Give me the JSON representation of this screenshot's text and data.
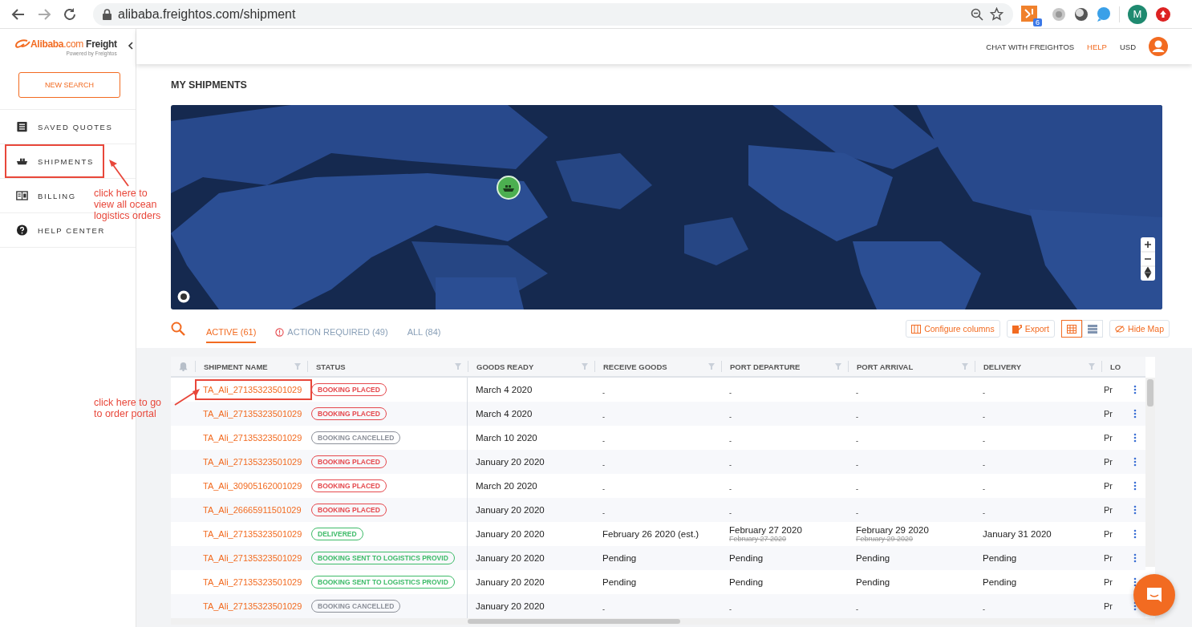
{
  "browser": {
    "url": "alibaba.freightos.com/shipment",
    "extension_badge": "6",
    "profile_initial": "M"
  },
  "sidebar": {
    "logo": {
      "brand": "Alibaba",
      "domain": ".com",
      "product": "Freight",
      "tagline": "Powered by Freightos"
    },
    "new_search": "NEW SEARCH",
    "items": [
      {
        "label": "SAVED QUOTES",
        "kind": "quotes",
        "annotated": false
      },
      {
        "label": "SHIPMENTS",
        "kind": "ship",
        "annotated": true
      },
      {
        "label": "BILLING",
        "kind": "billing",
        "annotated": false
      },
      {
        "label": "HELP CENTER",
        "kind": "help",
        "annotated": false
      }
    ]
  },
  "topbar": {
    "links": [
      {
        "label": "CHAT WITH FREIGHTOS",
        "selected": false
      },
      {
        "label": "HELP",
        "selected": true
      },
      {
        "label": "USD",
        "selected": false
      }
    ]
  },
  "page_title": "MY SHIPMENTS",
  "tabs": [
    {
      "label": "ACTIVE (61)",
      "selected": true,
      "alert": false
    },
    {
      "label": "ACTION REQUIRED (49)",
      "selected": false,
      "alert": true
    },
    {
      "label": "ALL (84)",
      "selected": false,
      "alert": false
    }
  ],
  "toolbar": {
    "configure": "Configure columns",
    "export": "Export",
    "views": [
      {
        "kind": "grid",
        "selected": true
      },
      {
        "kind": "list",
        "selected": false
      }
    ],
    "hide_map": "Hide Map"
  },
  "table": {
    "columns": [
      {
        "label": "SHIPMENT NAME",
        "filterable": true
      },
      {
        "label": "STATUS",
        "filterable": true
      },
      {
        "label": "GOODS READY",
        "filterable": true
      },
      {
        "label": "RECEIVE GOODS",
        "filterable": true
      },
      {
        "label": "PORT DEPARTURE",
        "filterable": true
      },
      {
        "label": "PORT ARRIVAL",
        "filterable": true
      },
      {
        "label": "DELIVERY",
        "filterable": true
      },
      {
        "label": "LO",
        "filterable": false
      }
    ],
    "rows": [
      {
        "name": "TA_Ali_27135323501029",
        "annotated": true,
        "status": {
          "label": "BOOKING PLACED",
          "color": "#e5484d"
        },
        "dates": [
          {
            "value": "March 4 2020"
          },
          {
            "value": "-"
          },
          {
            "value": "-"
          },
          {
            "value": "-"
          },
          {
            "value": "-"
          }
        ],
        "column_8": "Pr"
      },
      {
        "name": "TA_Ali_27135323501029",
        "annotated": false,
        "status": {
          "label": "BOOKING PLACED",
          "color": "#e5484d"
        },
        "dates": [
          {
            "value": "March 4 2020"
          },
          {
            "value": "-"
          },
          {
            "value": "-"
          },
          {
            "value": "-"
          },
          {
            "value": "-"
          }
        ],
        "column_8": "Pr"
      },
      {
        "name": "TA_Ali_27135323501029",
        "annotated": false,
        "status": {
          "label": "BOOKING CANCELLED",
          "color": "#8c9099"
        },
        "dates": [
          {
            "value": "March 10 2020"
          },
          {
            "value": "-"
          },
          {
            "value": "-"
          },
          {
            "value": "-"
          },
          {
            "value": "-"
          }
        ],
        "column_8": "Pr"
      },
      {
        "name": "TA_Ali_27135323501029",
        "annotated": false,
        "status": {
          "label": "BOOKING PLACED",
          "color": "#e5484d"
        },
        "dates": [
          {
            "value": "January 20 2020"
          },
          {
            "value": "-"
          },
          {
            "value": "-"
          },
          {
            "value": "-"
          },
          {
            "value": "-"
          }
        ],
        "column_8": "Pr"
      },
      {
        "name": "TA_Ali_30905162001029",
        "annotated": false,
        "status": {
          "label": "BOOKING PLACED",
          "color": "#e5484d"
        },
        "dates": [
          {
            "value": "March 20 2020"
          },
          {
            "value": "-"
          },
          {
            "value": "-"
          },
          {
            "value": "-"
          },
          {
            "value": "-"
          }
        ],
        "column_8": "Pr"
      },
      {
        "name": "TA_Ali_26665911501029",
        "annotated": false,
        "status": {
          "label": "BOOKING PLACED",
          "color": "#e5484d"
        },
        "dates": [
          {
            "value": "January 20 2020"
          },
          {
            "value": "-"
          },
          {
            "value": "-"
          },
          {
            "value": "-"
          },
          {
            "value": "-"
          }
        ],
        "column_8": "Pr"
      },
      {
        "name": "TA_Ali_27135323501029",
        "annotated": false,
        "status": {
          "label": "DELIVERED",
          "color": "#3dbb68"
        },
        "dates": [
          {
            "value": "January 20 2020"
          },
          {
            "value": "February 26 2020 (est.)"
          },
          {
            "value": "February 27 2020",
            "previous": "February 27 2020"
          },
          {
            "value": "February 29 2020",
            "previous": "February 29 2020"
          },
          {
            "value": "January 31 2020"
          }
        ],
        "column_8": "Pr"
      },
      {
        "name": "TA_Ali_27135323501029",
        "annotated": false,
        "status": {
          "label": "BOOKING SENT TO LOGISTICS PROVID",
          "color": "#3dbb68"
        },
        "dates": [
          {
            "value": "January 20 2020"
          },
          {
            "value": "Pending"
          },
          {
            "value": "Pending"
          },
          {
            "value": "Pending"
          },
          {
            "value": "Pending"
          }
        ],
        "column_8": "Pr"
      },
      {
        "name": "TA_Ali_27135323501029",
        "annotated": false,
        "status": {
          "label": "BOOKING SENT TO LOGISTICS PROVID",
          "color": "#3dbb68"
        },
        "dates": [
          {
            "value": "January 20 2020"
          },
          {
            "value": "Pending"
          },
          {
            "value": "Pending"
          },
          {
            "value": "Pending"
          },
          {
            "value": "Pending"
          }
        ],
        "column_8": "Pr"
      },
      {
        "name": "TA_Ali_27135323501029",
        "annotated": false,
        "status": {
          "label": "BOOKING CANCELLED",
          "color": "#8c9099"
        },
        "dates": [
          {
            "value": "January 20 2020"
          },
          {
            "value": "-"
          },
          {
            "value": "-"
          },
          {
            "value": "-"
          },
          {
            "value": "-"
          }
        ],
        "column_8": "Pr"
      }
    ]
  },
  "annotations": [
    {
      "text": "click here to view all ocean logistics orders"
    },
    {
      "text": "click here to go to order portal"
    }
  ]
}
